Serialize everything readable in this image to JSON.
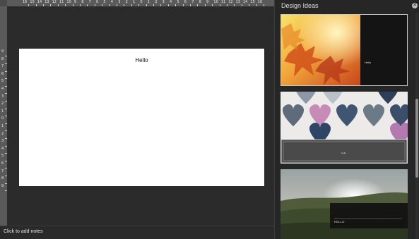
{
  "ruler": {
    "horizontal": [
      "16",
      "15",
      "14",
      "13",
      "12",
      "11",
      "10",
      "9",
      "8",
      "7",
      "6",
      "5",
      "4",
      "3",
      "2",
      "1",
      "0",
      "1",
      "2",
      "3",
      "4",
      "5",
      "6",
      "7",
      "8",
      "9",
      "10",
      "11",
      "12",
      "13",
      "14",
      "15",
      "16"
    ],
    "vertical": [
      "9",
      "8",
      "7",
      "6",
      "5",
      "4",
      "3",
      "2",
      "1",
      "0",
      "1",
      "2",
      "3",
      "4",
      "5",
      "6",
      "7",
      "8",
      "9"
    ]
  },
  "slide": {
    "title": "Hello"
  },
  "notes": {
    "placeholder": "Click to add notes"
  },
  "pane": {
    "title": "Design Ideas",
    "ideas": [
      {
        "text": "Hello",
        "accent": "#f4e2a0"
      },
      {
        "text": "Hello"
      },
      {
        "text": "HELLO"
      }
    ]
  },
  "colors": {
    "background": "#2b2b2b",
    "slide": "#ffffff",
    "ruler": "#5a5a5a"
  },
  "icons": {
    "close": "close-icon"
  }
}
